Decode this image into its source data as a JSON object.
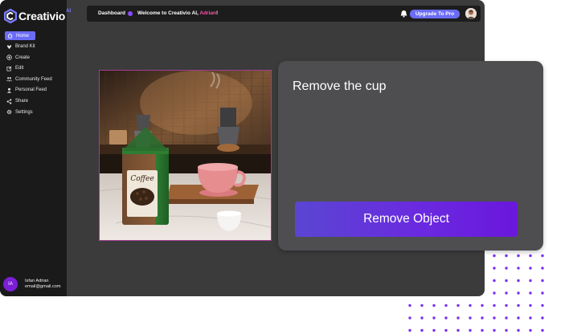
{
  "app": {
    "brand": "Creativio",
    "brand_suffix": "AI"
  },
  "sidebar": {
    "items": [
      {
        "label": "Home",
        "icon": "home-icon",
        "active": true
      },
      {
        "label": "Brand Kit",
        "icon": "brand-kit-icon",
        "active": false
      },
      {
        "label": "Create",
        "icon": "plus-circle-icon",
        "active": false
      },
      {
        "label": "Edit",
        "icon": "edit-icon",
        "active": false
      },
      {
        "label": "Community Feed",
        "icon": "community-icon",
        "active": false
      },
      {
        "label": "Personal Feed",
        "icon": "user-icon",
        "active": false
      },
      {
        "label": "Share",
        "icon": "share-icon",
        "active": false
      },
      {
        "label": "Settings",
        "icon": "gear-icon",
        "active": false
      }
    ]
  },
  "user": {
    "initials": "IA",
    "name": "Isfan Adrian",
    "email": "email@gmail.com"
  },
  "header": {
    "breadcrumb": "Dashboard",
    "welcome_prefix": "Welcome to Creativio AI, ",
    "welcome_name": "Adrian",
    "welcome_suffix": "!",
    "upgrade_label": "Upgrade To Pro"
  },
  "editor": {
    "prompt_text": "Remove the cup",
    "action_label": "Remove Object",
    "product_label": "Coffee"
  },
  "colors": {
    "accent": "#6b6cf5",
    "highlight": "#ff4fa3",
    "button_gradient_start": "#5a46d2",
    "button_gradient_end": "#6a17dc",
    "dots": "#7b2ff2"
  }
}
